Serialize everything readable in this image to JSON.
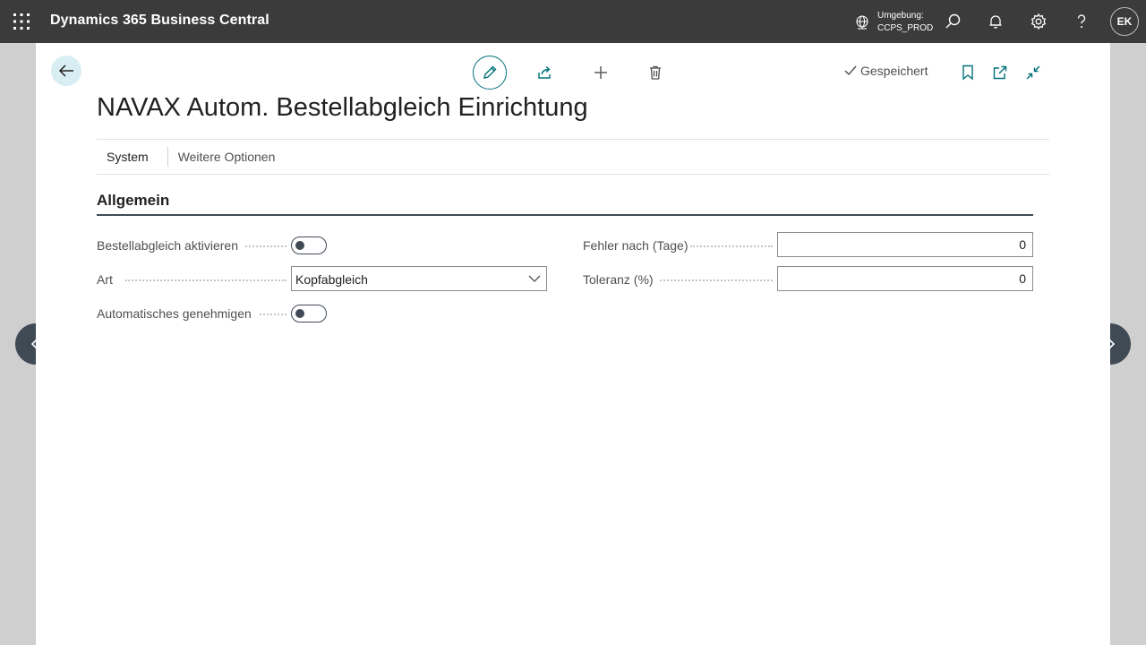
{
  "app": {
    "title": "Dynamics 365 Business Central"
  },
  "topbar": {
    "environment_label": "Umgebung:",
    "environment_value": "CCPS_PROD",
    "user_initials": "EK"
  },
  "actions": {
    "saved_status": "Gespeichert"
  },
  "page": {
    "title": "NAVAX Autom. Bestellabgleich Einrichtung"
  },
  "tabs": [
    {
      "label": "System"
    },
    {
      "label": "Weitere Optionen"
    }
  ],
  "section": {
    "title": "Allgemein",
    "fields_left": [
      {
        "label": "Bestellabgleich aktivieren",
        "type": "toggle",
        "value": false
      },
      {
        "label": "Art",
        "type": "select",
        "value": "Kopfabgleich"
      },
      {
        "label": "Automatisches genehmigen",
        "type": "toggle",
        "value": false
      }
    ],
    "fields_right": [
      {
        "label": "Fehler nach (Tage)",
        "type": "number",
        "value": "0"
      },
      {
        "label": "Toleranz (%)",
        "type": "number",
        "value": "0"
      }
    ]
  },
  "colors": {
    "topbar_bg": "#3b3b3b",
    "accent": "#00717a",
    "nav_circle": "#3f4a55"
  }
}
